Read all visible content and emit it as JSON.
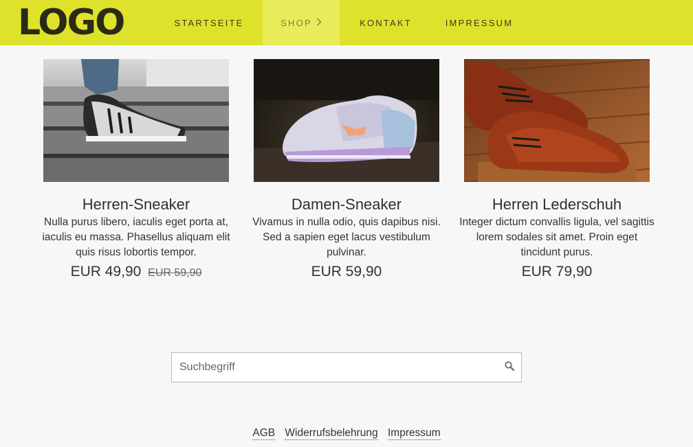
{
  "header": {
    "logo": "LOGO",
    "nav": {
      "home": "STARTSEITE",
      "shop": "SHOP",
      "kontakt": "KONTAKT",
      "impressum": "IMPRESSUM"
    },
    "active_tab": "SHOP"
  },
  "products": [
    {
      "image_icon": "sneaker-on-stairs-photo",
      "title": "Herren-Sneaker",
      "description": "Nulla purus libero, iaculis eget porta at, iaculis eu massa. Phasellus aliquam elit quis risus lobortis tempor.",
      "price": "EUR 49,90",
      "old_price": "EUR 59,90"
    },
    {
      "image_icon": "womens-sneaker-photo",
      "title": "Damen-Sneaker",
      "description": "Vivamus in nulla odio, quis dapibus nisi. Sed a sapien eget lacus vestibulum pulvinar.",
      "price": "EUR 59,90"
    },
    {
      "image_icon": "leather-shoes-photo",
      "title": "Herren Lederschuh",
      "description": "Integer dictum convallis ligula, vel sagittis lorem sodales sit amet. Proin eget tincidunt purus.",
      "price": "EUR 79,90"
    }
  ],
  "search": {
    "placeholder": "Suchbegriff",
    "value": ""
  },
  "footer": {
    "links": [
      "AGB",
      "Widerrufsbelehrung",
      "Impressum"
    ]
  },
  "colors": {
    "header_bg": "#dfe22a",
    "active_tab_bg": "#e8eb5a",
    "page_bg": "#f7f7f7"
  }
}
